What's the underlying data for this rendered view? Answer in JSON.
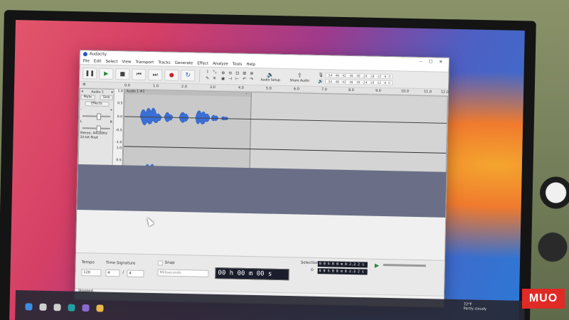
{
  "window": {
    "title": "Audacity"
  },
  "menu": [
    "File",
    "Edit",
    "Select",
    "View",
    "Transport",
    "Tracks",
    "Generate",
    "Effect",
    "Analyze",
    "Tools",
    "Help"
  ],
  "toolbar": {
    "audio_setup_label": "Audio Setup",
    "share_audio_label": "Share Audio",
    "meter_scale": [
      "-54",
      "-48",
      "-42",
      "-36",
      "-30",
      "-24",
      "-18",
      "-12",
      "-6",
      "0"
    ]
  },
  "ruler": [
    "0.0",
    "1.0",
    "2.0",
    "3.0",
    "4.0",
    "5.0",
    "6.0",
    "7.0",
    "8.0",
    "9.0",
    "10.0",
    "11.0",
    "12.0"
  ],
  "track": {
    "name": "Audio 1",
    "clip_name": "Audio 1 #1",
    "mute_label": "Mute",
    "solo_label": "Solo",
    "effects_label": "Effects",
    "gain_minus": "-",
    "gain_plus": "+",
    "pan_left": "L",
    "pan_right": "R",
    "info_line1": "Stereo, 44100Hz",
    "info_line2": "32-bit float",
    "select_label": "Select",
    "scale": [
      "1.0",
      "0.5",
      "0.0",
      "-0.5",
      "-1.0",
      "1.0",
      "0.5",
      "0.0",
      "-0.5",
      "-1.0"
    ]
  },
  "bottom": {
    "tempo_label": "Tempo",
    "tempo_value": "120",
    "time_signature_label": "Time Signature",
    "ts_upper": "4",
    "ts_lower": "4",
    "snap_label": "Snap",
    "snap_unit": "Milliseconds",
    "time_display": "00 h 00 m 00 s",
    "selection_label": "Selection",
    "selection_start": "0 0 h 0 0 m 0 2.3 2 s",
    "selection_end": "0 0 h 0 0 m 0 2.3 2 s"
  },
  "status": "Stopped.",
  "taskbar": {
    "temperature": "72°F",
    "weather": "Partly cloudy"
  },
  "watermark": "MUO",
  "colors": {
    "waveform": "#3a6fd6",
    "record": "#c8232c",
    "play": "#1c8a3a",
    "track_area": "#6a6f87"
  }
}
